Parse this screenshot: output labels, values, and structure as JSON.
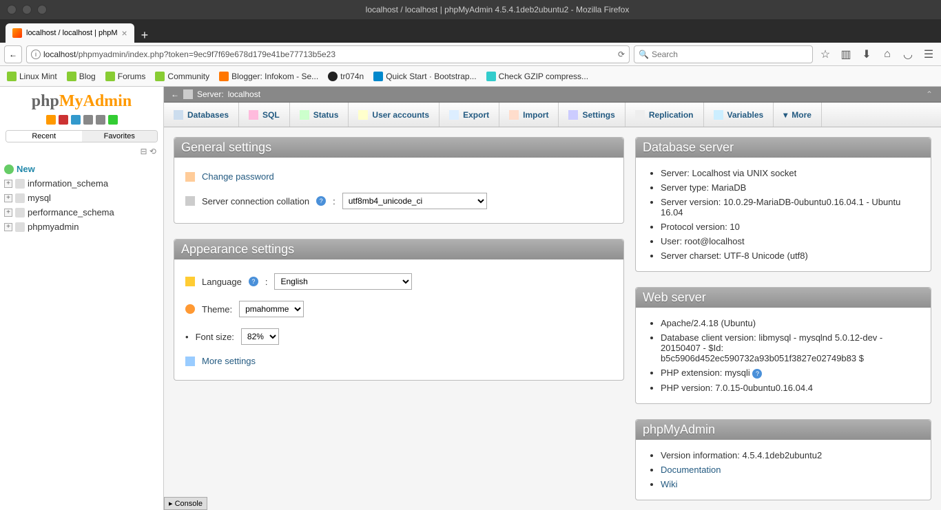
{
  "window": {
    "title": "localhost / localhost | phpMyAdmin 4.5.4.1deb2ubuntu2 - Mozilla Firefox"
  },
  "tab": {
    "title": "localhost / localhost | phpM"
  },
  "url": {
    "host": "localhost",
    "path": "/phpmyadmin/index.php?token=9ec9f7f69e678d179e41be77713b5e23"
  },
  "search": {
    "placeholder": "Search"
  },
  "bookmarks": [
    {
      "label": "Linux Mint"
    },
    {
      "label": "Blog"
    },
    {
      "label": "Forums"
    },
    {
      "label": "Community"
    },
    {
      "label": "Blogger: Infokom - Se..."
    },
    {
      "label": "tr074n"
    },
    {
      "label": "Quick Start · Bootstrap..."
    },
    {
      "label": "Check GZIP compress..."
    }
  ],
  "sidebar": {
    "tabs": {
      "recent": "Recent",
      "favorites": "Favorites"
    },
    "new": "New",
    "dbs": [
      "information_schema",
      "mysql",
      "performance_schema",
      "phpmyadmin"
    ]
  },
  "breadcrumb": {
    "server_label": "Server:",
    "server": "localhost"
  },
  "topnav": [
    {
      "label": "Databases"
    },
    {
      "label": "SQL"
    },
    {
      "label": "Status"
    },
    {
      "label": "User accounts"
    },
    {
      "label": "Export"
    },
    {
      "label": "Import"
    },
    {
      "label": "Settings"
    },
    {
      "label": "Replication"
    },
    {
      "label": "Variables"
    },
    {
      "label": "More"
    }
  ],
  "general": {
    "title": "General settings",
    "change_pw": "Change password",
    "collation_label": "Server connection collation",
    "collation_value": "utf8mb4_unicode_ci"
  },
  "appearance": {
    "title": "Appearance settings",
    "lang_label": "Language",
    "lang_value": "English",
    "theme_label": "Theme:",
    "theme_value": "pmahomme",
    "fontsize_label": "Font size:",
    "fontsize_value": "82%",
    "more": "More settings"
  },
  "dbserver": {
    "title": "Database server",
    "items": [
      "Server: Localhost via UNIX socket",
      "Server type: MariaDB",
      "Server version: 10.0.29-MariaDB-0ubuntu0.16.04.1 - Ubuntu 16.04",
      "Protocol version: 10",
      "User: root@localhost",
      "Server charset: UTF-8 Unicode (utf8)"
    ]
  },
  "webserver": {
    "title": "Web server",
    "items": [
      "Apache/2.4.18 (Ubuntu)",
      "Database client version: libmysql - mysqlnd 5.0.12-dev - 20150407 - $Id: b5c5906d452ec590732a93b051f3827e02749b83 $",
      "PHP extension: mysqli",
      "PHP version: 7.0.15-0ubuntu0.16.04.4"
    ]
  },
  "pma": {
    "title": "phpMyAdmin",
    "version": "Version information: 4.5.4.1deb2ubuntu2",
    "links": [
      "Documentation",
      "Wiki"
    ]
  },
  "console": "Console"
}
